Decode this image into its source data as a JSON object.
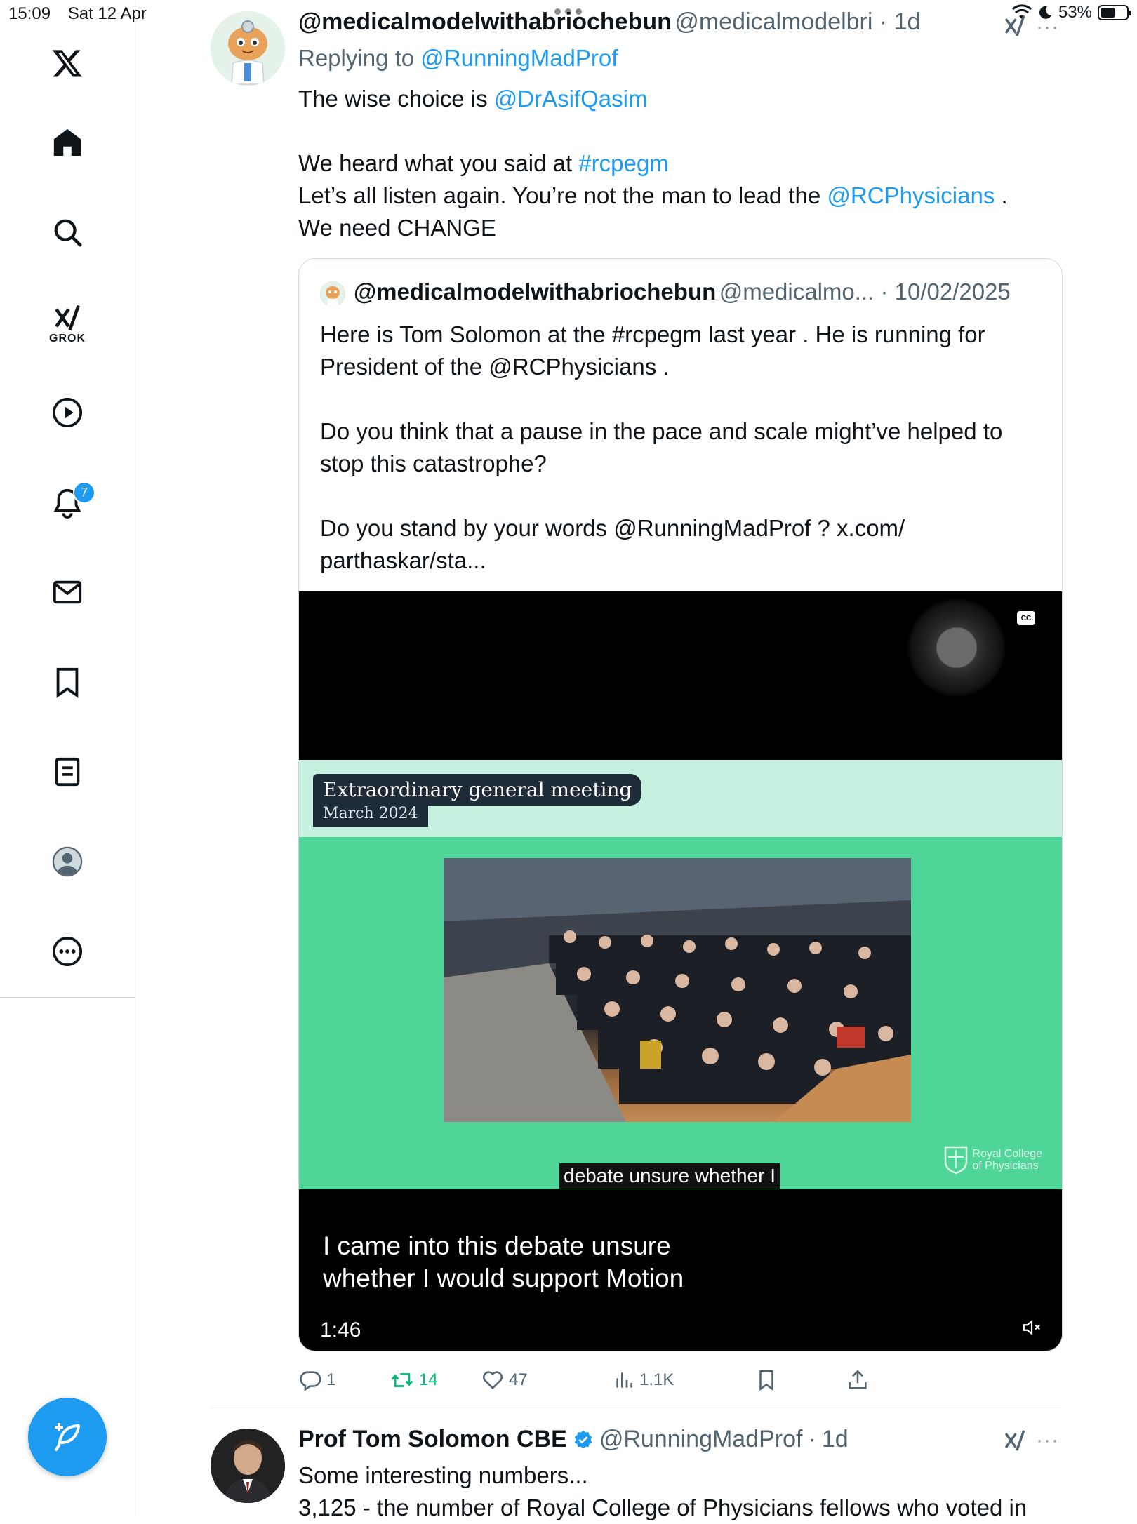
{
  "status_bar": {
    "time": "15:09",
    "date": "Sat 12 Apr",
    "battery": "53%",
    "battery_level": 0.53
  },
  "sidebar": {
    "grok_label": "GROK",
    "notification_count": "7",
    "icons": [
      "x-logo-icon",
      "home-icon",
      "search-icon",
      "grok-icon",
      "video-icon",
      "notifications-icon",
      "messages-icon",
      "bookmarks-icon",
      "lists-icon",
      "profile-icon",
      "more-icon"
    ]
  },
  "tweet": {
    "name": "@medicalmodelwithabriochebun",
    "handle": "@medicalmodelbri",
    "time": "1d",
    "replying_prefix": "Replying to",
    "replying_to": "@RunningMadProf",
    "line1_text": "The wise choice is",
    "line1_mention": "@DrAsifQasim",
    "line2_text": "We heard what you said at",
    "line2_hashtag": "#rcpegm",
    "line3_text": "Let’s all listen again. You’re not the man to lead the",
    "line3_mention": "@RCPhysicians",
    "line3_end": ".",
    "line4_text": "We need CHANGE",
    "quote": {
      "name": "@medicalmodelwithabriochebun",
      "handle": "@medicalmo...",
      "date": "10/02/2025",
      "p1a": "Here is Tom Solomon at the #rcpegm last year . He is running for",
      "p1b": "President of the @RCPhysicians .",
      "p2a": "Do you think that a pause in the pace and scale might’ve helped to",
      "p2b": "stop this catastrophe?",
      "p3a": "Do you stand by your words @RunningMadProf ? x.com/",
      "p3b": "parthaskar/sta...",
      "video": {
        "title_tag": "Extraordinary general meeting",
        "date_tag": "March 2024",
        "logo_line1": "Royal College",
        "logo_line2": "of Physicians",
        "burned_subtitle": "debate unsure whether I",
        "caption_line1": "I came into this debate unsure",
        "caption_line2": "whether I would support Motion",
        "duration": "1:46",
        "cc": "CC"
      }
    },
    "actions": {
      "replies": "1",
      "reposts": "14",
      "likes": "47",
      "views": "1.1K"
    },
    "colors": {
      "link": "#1d9bf0",
      "repost_active": "#00ba7c"
    }
  },
  "next_tweet": {
    "name": "Prof Tom Solomon CBE",
    "handle": "@RunningMadProf",
    "time": "1d",
    "line1": "Some interesting numbers...",
    "line2": "3,125 - the number of Royal College of Physicians fellows who voted in"
  }
}
